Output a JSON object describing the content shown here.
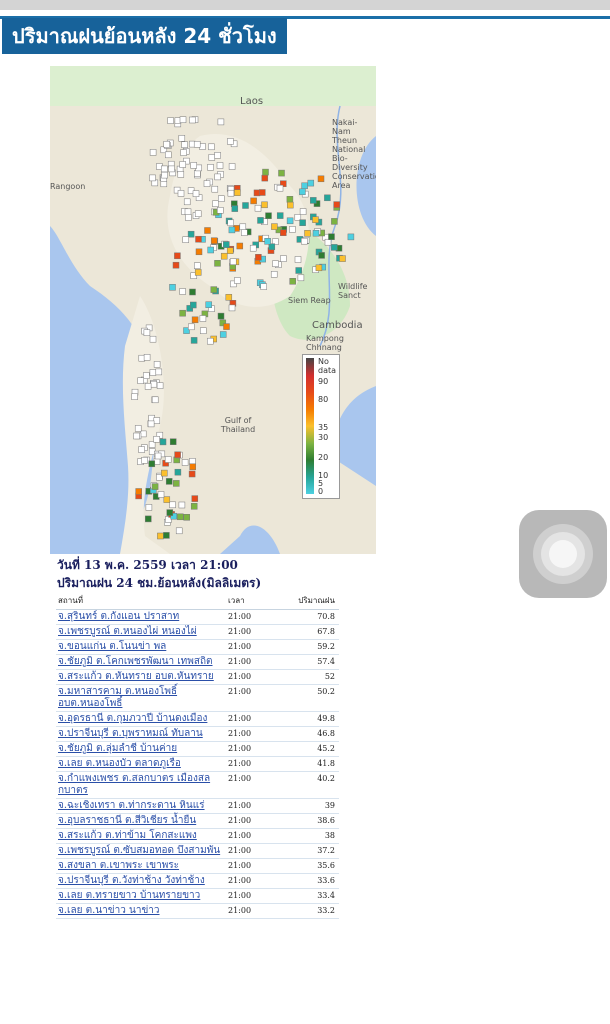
{
  "header": {
    "title": "ปริมาณฝนย้อนหลัง 24 ชั่วโมง"
  },
  "map": {
    "place_labels": [
      "Laos",
      "Nakai-Nam Theun National Bio-Diversity Conservation Area",
      "Rangoon",
      "Gulf of Thailand",
      "Cambodia",
      "Siem Reap",
      "Kampong Chhnang",
      "Wildlife Sanct"
    ],
    "legend": [
      "No data",
      "90",
      "80",
      "35",
      "30",
      "20",
      "10",
      "5",
      "0"
    ],
    "legend_colors": [
      "#444444",
      "#d32f2f",
      "#e64a19",
      "#f57c00",
      "#fbc02d",
      "#7cb342",
      "#2e7d32",
      "#26a69a",
      "#4dd0e1"
    ]
  },
  "report": {
    "date_line": "วันที่ 13 พ.ค. 2559 เวลา 21:00",
    "table_title": "ปริมาณฝน 24 ชม.ย้อนหลัง(มิลลิเมตร)",
    "columns": [
      "สถานที่",
      "เวลา",
      "ปริมาณฝน"
    ],
    "rows": [
      {
        "station": "จ.สุรินทร์ ต.กังแอน ปราสาท",
        "time": "21:00",
        "rain": "70.8"
      },
      {
        "station": "จ.เพชรบูรณ์ ต.หนองไผ่ หนองไผ่",
        "time": "21:00",
        "rain": "67.8"
      },
      {
        "station": "จ.ขอนแก่น ต.โนนข่า พล",
        "time": "21:00",
        "rain": "59.2"
      },
      {
        "station": "จ.ชัยภูมิ ต.โคกเพชรพัฒนา เทพสถิต",
        "time": "21:00",
        "rain": "57.4"
      },
      {
        "station": "จ.สระแก้ว ต.หันทราย อบต.หันทราย",
        "time": "21:00",
        "rain": "52"
      },
      {
        "station": "จ.มหาสารคาม ต.หนองโพธิ์ อบต.หนองโพธิ์",
        "time": "21:00",
        "rain": "50.2"
      },
      {
        "station": "จ.อุดรธานี ต.กุมภวาปี บ้านดงเมือง",
        "time": "21:00",
        "rain": "49.8"
      },
      {
        "station": "จ.ปราจีนบุรี ต.บุพราหมณ์ ทับลาน",
        "time": "21:00",
        "rain": "46.8"
      },
      {
        "station": "จ.ชัยภูมิ ต.ลุ่มลำชี บ้านค่าย",
        "time": "21:00",
        "rain": "45.2"
      },
      {
        "station": "จ.เลย ต.หนองบัว ตลาดภูเรือ",
        "time": "21:00",
        "rain": "41.8"
      },
      {
        "station": "จ.กำแพงเพชร ต.สลกบาตร เมืองสลกบาตร",
        "time": "21:00",
        "rain": "40.2"
      },
      {
        "station": "จ.ฉะเชิงเทรา ต.ท่ากระดาน หินแร่",
        "time": "21:00",
        "rain": "39"
      },
      {
        "station": "จ.อุบลราชธานี ต.สีวิเชียร น้ำยืน",
        "time": "21:00",
        "rain": "38.6"
      },
      {
        "station": "จ.สระแก้ว ต.ท่าข้าม โคกสะแพง",
        "time": "21:00",
        "rain": "38"
      },
      {
        "station": "จ.เพชรบูรณ์ ต.ซับสมอทอด บึงสามพัน",
        "time": "21:00",
        "rain": "37.2"
      },
      {
        "station": "จ.สงขลา ต.เขาพระ เขาพระ",
        "time": "21:00",
        "rain": "35.6"
      },
      {
        "station": "จ.ปราจีนบุรี ต.วังท่าช้าง วังท่าช้าง",
        "time": "21:00",
        "rain": "33.6"
      },
      {
        "station": "จ.เลย ต.ทรายขาว บ้านทรายขาว",
        "time": "21:00",
        "rain": "33.4"
      },
      {
        "station": "จ.เลย ต.นาข่าว นาข่าว",
        "time": "21:00",
        "rain": "33.2"
      }
    ]
  }
}
